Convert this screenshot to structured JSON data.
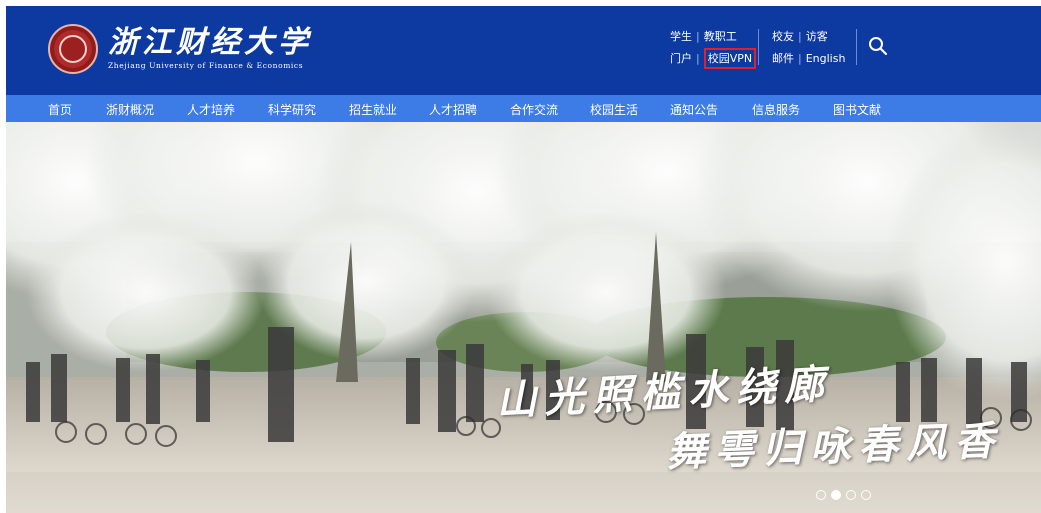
{
  "header": {
    "logo": {
      "name_cn": "浙江财经大学",
      "name_en": "Zhejiang University of Finance & Economics"
    },
    "quick_links": {
      "row1": [
        "学生",
        "教职工",
        "校友",
        "访客"
      ],
      "row2": [
        "门户",
        "校园VPN",
        "邮件",
        "English"
      ]
    },
    "highlighted_link": "校园VPN",
    "highlight_color": "#e0202a",
    "search_icon": "search-icon"
  },
  "nav": {
    "items": [
      "首页",
      "浙财概况",
      "人才培养",
      "科学研究",
      "招生就业",
      "人才招聘",
      "合作交流",
      "校园生活",
      "通知公告",
      "信息服务",
      "图书文献"
    ]
  },
  "banner": {
    "caption_line1": "山光照槛水绕廊",
    "caption_line2": "舞雩归咏春风香",
    "carousel": {
      "total": 4,
      "active_index": 1
    }
  },
  "colors": {
    "header_bg": "#0d3aa0",
    "nav_bg": "#3d7ce6",
    "text": "#ffffff"
  }
}
